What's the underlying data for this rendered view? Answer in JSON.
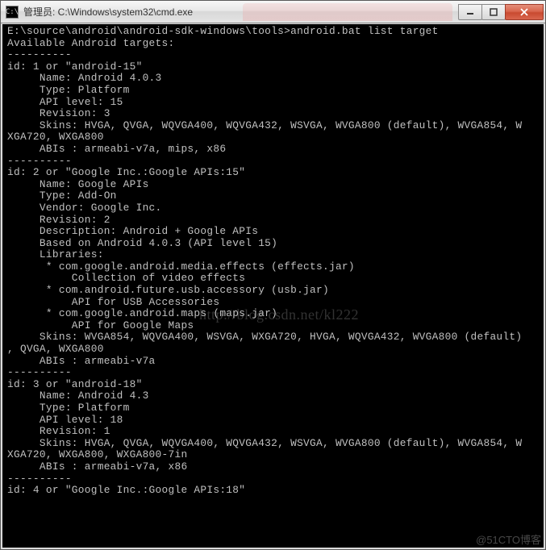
{
  "window": {
    "title": "管理员: C:\\Windows\\system32\\cmd.exe",
    "icon_label": "cmd"
  },
  "controls": {
    "minimize": "—",
    "maximize": "☐",
    "close": "✕"
  },
  "terminal": {
    "content": "E:\\source\\android\\android-sdk-windows\\tools>android.bat list target\nAvailable Android targets:\n----------\nid: 1 or \"android-15\"\n     Name: Android 4.0.3\n     Type: Platform\n     API level: 15\n     Revision: 3\n     Skins: HVGA, QVGA, WQVGA400, WQVGA432, WSVGA, WVGA800 (default), WVGA854, W\nXGA720, WXGA800\n     ABIs : armeabi-v7a, mips, x86\n----------\nid: 2 or \"Google Inc.:Google APIs:15\"\n     Name: Google APIs\n     Type: Add-On\n     Vendor: Google Inc.\n     Revision: 2\n     Description: Android + Google APIs\n     Based on Android 4.0.3 (API level 15)\n     Libraries:\n      * com.google.android.media.effects (effects.jar)\n          Collection of video effects\n      * com.android.future.usb.accessory (usb.jar)\n          API for USB Accessories\n      * com.google.android.maps (maps.jar)\n          API for Google Maps\n     Skins: WVGA854, WQVGA400, WSVGA, WXGA720, HVGA, WQVGA432, WVGA800 (default)\n, QVGA, WXGA800\n     ABIs : armeabi-v7a\n----------\nid: 3 or \"android-18\"\n     Name: Android 4.3\n     Type: Platform\n     API level: 18\n     Revision: 1\n     Skins: HVGA, QVGA, WQVGA400, WQVGA432, WSVGA, WVGA800 (default), WVGA854, W\nXGA720, WXGA800, WXGA800-7in\n     ABIs : armeabi-v7a, x86\n----------\nid: 4 or \"Google Inc.:Google APIs:18\""
  },
  "watermarks": {
    "url": "http://blog.csdn.net/kl222",
    "corner": "@51CTO博客"
  }
}
